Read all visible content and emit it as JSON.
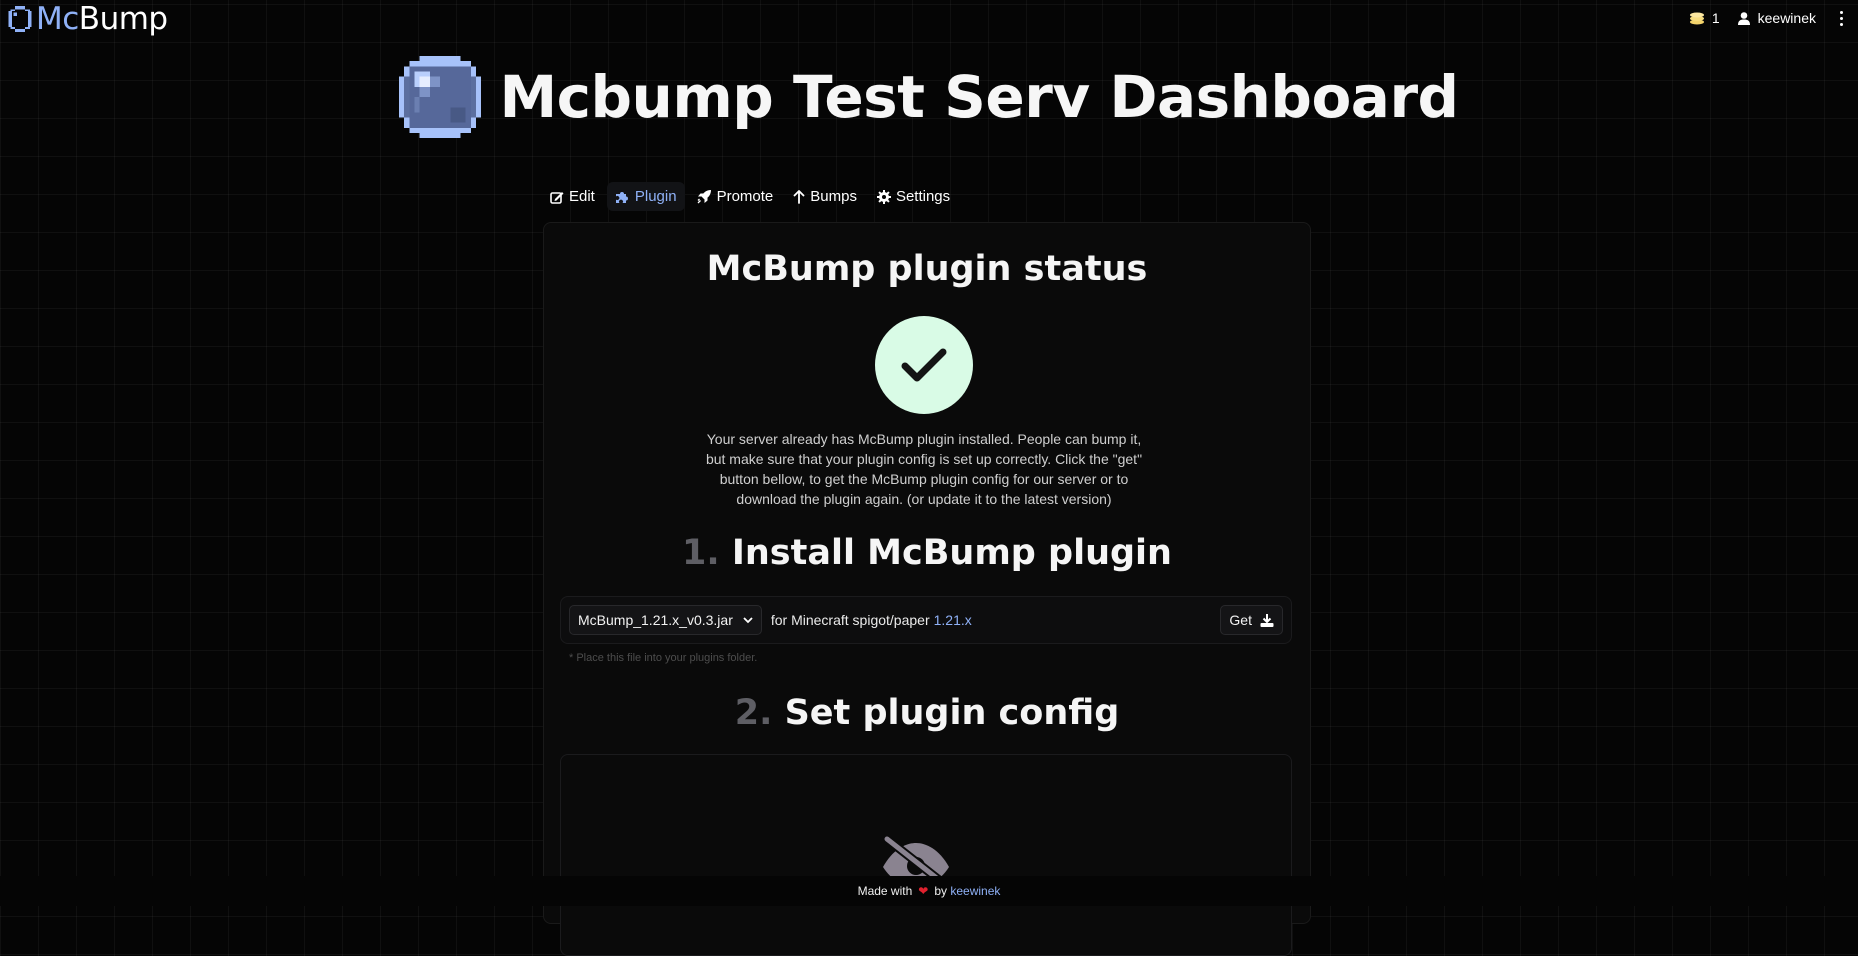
{
  "brand": {
    "mc": "Mc",
    "bump": "Bump"
  },
  "topbar": {
    "coins": "1",
    "username": "keewinek"
  },
  "hero": {
    "title": "Mcbump Test Serv Dashboard"
  },
  "tabs": [
    {
      "label": "Edit",
      "icon": "edit-icon"
    },
    {
      "label": "Plugin",
      "icon": "puzzle-icon",
      "active": true
    },
    {
      "label": "Promote",
      "icon": "rocket-icon"
    },
    {
      "label": "Bumps",
      "icon": "arrow-up-icon"
    },
    {
      "label": "Settings",
      "icon": "gear-icon"
    }
  ],
  "plugin": {
    "title": "McBump plugin status",
    "description": "Your server already has McBump plugin installed. People can bump it, but make sure that your plugin config is set up correctly. Click the \"get\" button bellow, to get the McBump plugin config for our server or to download the plugin again. (or update it to the latest version)",
    "step1": {
      "num": "1.",
      "title": "Install McBump plugin"
    },
    "download": {
      "file": "McBump_1.21.x_v0.3.jar",
      "for_label": "for Minecraft spigot/paper",
      "version": "1.21.x",
      "get_label": "Get"
    },
    "hint": "* Place this file into your plugins folder.",
    "step2": {
      "num": "2.",
      "title": "Set plugin config"
    }
  },
  "footer": {
    "made_with": "Made with",
    "by": "by",
    "author": "keewinek"
  },
  "colors": {
    "accent": "#8fb1f7",
    "background": "#050505",
    "success_bg": "#d9fbe6",
    "heart": "#e0212e"
  }
}
